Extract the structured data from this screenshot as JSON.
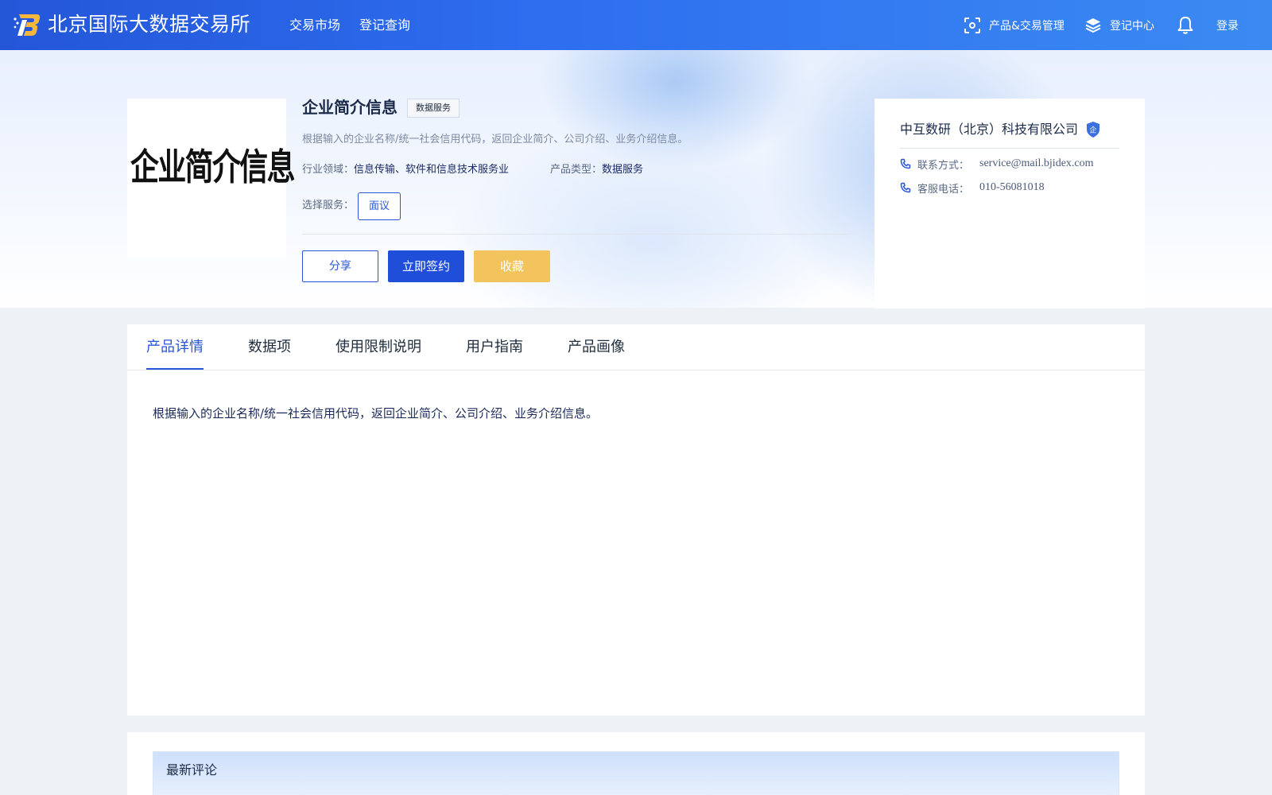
{
  "header": {
    "site_name": "北京国际大数据交易所",
    "nav": [
      "交易市场",
      "登记查询"
    ],
    "right_nav": {
      "product_trade": "产品&交易管理",
      "register_center": "登记中心",
      "login": "登录"
    }
  },
  "product": {
    "image_text": "企业简介信息",
    "title": "企业简介信息",
    "type_tag": "数据服务",
    "description": "根据输入的企业名称/统一社会信用代码，返回企业简介、公司介绍、业务介绍信息。",
    "industry_label": "行业领域：",
    "industry_value": "信息传输、软件和信息技术服务业",
    "product_type_label": "产品类型：",
    "product_type_value": "数据服务",
    "service_label": "选择服务：",
    "service_option": "面议",
    "buttons": {
      "share": "分享",
      "sign": "立即签约",
      "favorite": "收藏"
    }
  },
  "company": {
    "name": "中互数研（北京）科技有限公司",
    "badge_text": "企",
    "contact_label": "联系方式：",
    "contact_value": "service@mail.bjidex.com",
    "phone_label": "客服电话：",
    "phone_value": "010-56081018"
  },
  "tabs": {
    "items": [
      "产品详情",
      "数据项",
      "使用限制说明",
      "用户指南",
      "产品画像"
    ],
    "active_index": 0
  },
  "detail": {
    "content": "根据输入的企业名称/统一社会信用代码，返回企业简介、公司介绍、业务介绍信息。"
  },
  "comments": {
    "title": "最新评论"
  },
  "colors": {
    "primary": "#2a55d6",
    "favorite": "#f3c35e",
    "header_gradient_start": "#2456d8",
    "header_gradient_end": "#3b8af2"
  },
  "icons": {
    "logo": "bjidex-logo-icon",
    "product_trade": "scan-frame-icon",
    "register_center": "layers-icon",
    "notifications": "bell-icon",
    "company_badge": "shield-icon",
    "contact": "phone-icon"
  }
}
